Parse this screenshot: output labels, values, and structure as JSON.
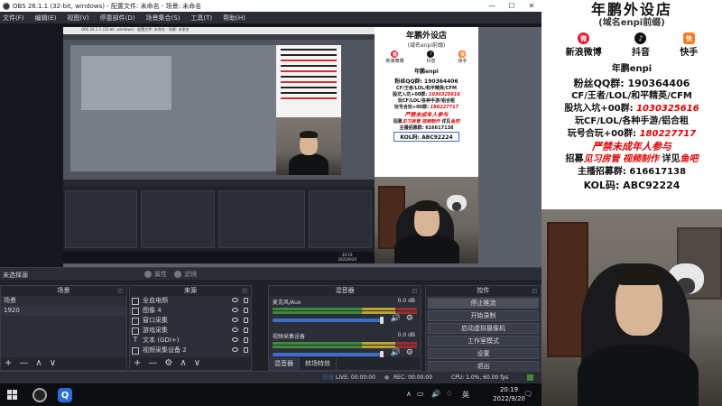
{
  "window": {
    "title": "OBS 26.1.1 (32-bit, windows) - 配置文件: 未命名 - 场景: 未命名",
    "controls": [
      "—",
      "☐",
      "✕"
    ]
  },
  "menu": [
    "文件(F)",
    "编辑(E)",
    "视图(V)",
    "停靠部件(D)",
    "场景集合(S)",
    "工具(T)",
    "帮助(H)"
  ],
  "nested": {
    "title": "OBS 26.1.1 (32-bit, windows) - 配置文件: 未命名 - 场景: 未命名"
  },
  "overlay": {
    "title": "年鹏外设店",
    "subtitle": "(域名enpi前缀)",
    "socials": [
      {
        "label": "新浪微博",
        "icon": "weibo-icon",
        "glyph": "微"
      },
      {
        "label": "抖音",
        "icon": "douyin-icon",
        "glyph": "♪"
      },
      {
        "label": "快手",
        "icon": "kuaishou-icon",
        "glyph": "快"
      }
    ],
    "handle": "年鹏enpi",
    "lines": [
      {
        "text": "粉丝QQ群: 190364406",
        "color": "black"
      },
      {
        "text": "CF/王者/LOL/和平精英/CFM",
        "color": "black"
      },
      {
        "text": "股坑入坑+00群: 1030325616",
        "color": "mixed",
        "pre": "股坑入坑+00群: ",
        "num": "1030325616"
      },
      {
        "text": "玩CF/LOL/各种手游/铝合租",
        "color": "black"
      },
      {
        "text": "玩号合玩+00群: 180227717",
        "color": "mixed",
        "pre": "玩号合玩+00群: ",
        "num": "180227717"
      },
      {
        "text": "严禁未成年人参与",
        "color": "red"
      },
      {
        "text": "招募见习房管 视频制作 详见鱼吧",
        "color": "mixed2",
        "a": "招募",
        "b": "见习房管 视频制作",
        "c": " 详见",
        "d": "鱼吧"
      },
      {
        "text": "主播招募群: 616617138",
        "color": "black"
      },
      {
        "text": "KOL码: ABC92224",
        "color": "kol"
      }
    ]
  },
  "status_strip": {
    "no_source": "未选择源",
    "properties": "属性",
    "filters": "滤镜"
  },
  "scenes": {
    "header": "场景",
    "items": [
      "场景",
      "1920"
    ],
    "footer": [
      "+",
      "—",
      "∧",
      "∨"
    ]
  },
  "sources": {
    "header": "来源",
    "items": [
      {
        "label": "全血电频",
        "icon": "image-icon"
      },
      {
        "label": "图像 4",
        "icon": "image-icon"
      },
      {
        "label": "窗口采集",
        "icon": "window-capture-icon"
      },
      {
        "label": "游戏采集",
        "icon": "game-capture-icon"
      },
      {
        "label": "文本 (GDI+)",
        "icon": "text-icon"
      },
      {
        "label": "视频采集设备 2",
        "icon": "camera-icon"
      }
    ],
    "footer": [
      "+",
      "—",
      "⚙",
      "∧",
      "∨"
    ]
  },
  "mixer": {
    "header": "混音器",
    "tracks": [
      {
        "name": "麦克风/Aux",
        "db": "0.0 dB"
      },
      {
        "name": "视频采集设备",
        "db": "0.0 dB"
      }
    ],
    "tabs": [
      "混音器",
      "转场特效"
    ]
  },
  "controls": {
    "header": "控件",
    "buttons": [
      "停止推流",
      "开始录制",
      "启动虚拟摄像机",
      "工作室模式",
      "设置",
      "退出"
    ]
  },
  "obs_status": {
    "live": "LIVE: 00:00:00",
    "rec": "REC: 00:00:00",
    "cpu": "CPU: 1.0%, 60.00 fps"
  },
  "taskbar": {
    "time": "20:19",
    "date": "2022/9/20",
    "lang": "英",
    "nested_time": "20:19",
    "nested_date": "2022/9/20"
  },
  "colors": {
    "obs_bg": "#1f2128",
    "accent_blue": "#3d6ec9",
    "overlay_red": "#e30000"
  }
}
